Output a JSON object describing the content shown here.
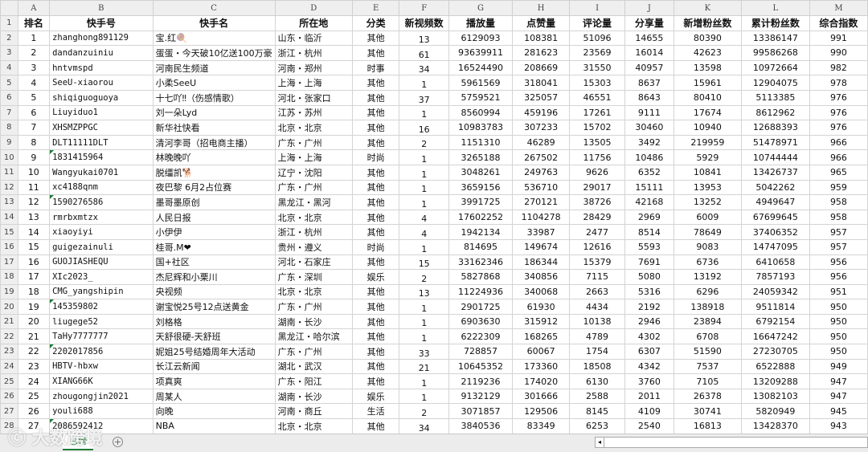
{
  "columns": [
    "A",
    "B",
    "C",
    "D",
    "E",
    "F",
    "G",
    "H",
    "I",
    "J",
    "K",
    "L",
    "M"
  ],
  "headers": [
    "排名",
    "快手号",
    "快手名",
    "所在地",
    "分类",
    "新视频数",
    "播放量",
    "点赞量",
    "评论量",
    "分享量",
    "新增粉丝数",
    "累计粉丝数",
    "综合指数"
  ],
  "rows": [
    [
      "1",
      "zhanghong891129",
      "宝.红🍭",
      "山东・临沂",
      "其他",
      "13",
      "6129093",
      "108381",
      "51096",
      "14655",
      "80390",
      "13386147",
      "991"
    ],
    [
      "2",
      "dandanzuiniu",
      "蛋蛋・今天破10亿送100万豪",
      "浙江・杭州",
      "其他",
      "61",
      "93639911",
      "281623",
      "23569",
      "16014",
      "42623",
      "99586268",
      "990"
    ],
    [
      "3",
      "hntvmspd",
      "河南民生频道",
      "河南・郑州",
      "时事",
      "34",
      "16524490",
      "208669",
      "31550",
      "40957",
      "13598",
      "10972664",
      "982"
    ],
    [
      "4",
      "SeeU-xiaorou",
      "小柔SeeU",
      "上海・上海",
      "其他",
      "1",
      "5961569",
      "318041",
      "15303",
      "8637",
      "15961",
      "12904075",
      "978"
    ],
    [
      "5",
      "shiqiguoguoya",
      "十七吖‼（伤感情歌）",
      "河北・张家口",
      "其他",
      "37",
      "5759521",
      "325057",
      "46551",
      "8643",
      "80410",
      "5113385",
      "976"
    ],
    [
      "6",
      "Liuyiduo1",
      "刘一朵Lyd",
      "江苏・苏州",
      "其他",
      "1",
      "8560994",
      "459196",
      "17261",
      "9111",
      "17674",
      "8612962",
      "976"
    ],
    [
      "7",
      "XHSMZPPGC",
      "新华社快看",
      "北京・北京",
      "其他",
      "16",
      "10983783",
      "307233",
      "15702",
      "30460",
      "10940",
      "12688393",
      "976"
    ],
    [
      "8",
      "DLT11111DLT",
      "清河李哥（招电商主播）",
      "广东・广州",
      "其他",
      "2",
      "1151310",
      "46289",
      "13505",
      "3492",
      "219959",
      "51478971",
      "966"
    ],
    [
      "9",
      "1831415964",
      "林晚晚吖",
      "上海・上海",
      "时尚",
      "1",
      "3265188",
      "267502",
      "11756",
      "10486",
      "5929",
      "10744444",
      "966"
    ],
    [
      "10",
      "Wangyukai0701",
      "脱缰凯🐕",
      "辽宁・沈阳",
      "其他",
      "1",
      "3048261",
      "249763",
      "9626",
      "6352",
      "10841",
      "13426737",
      "965"
    ],
    [
      "11",
      "xc4188qnm",
      "夜巴黎 6月2占位赛",
      "广东・广州",
      "其他",
      "1",
      "3659156",
      "536710",
      "29017",
      "15111",
      "13953",
      "5042262",
      "959"
    ],
    [
      "12",
      "1590276586",
      "墨哥墨原创",
      "黑龙江・黑河",
      "其他",
      "1",
      "3991725",
      "270121",
      "38726",
      "42168",
      "13252",
      "4949647",
      "958"
    ],
    [
      "13",
      "rmrbxmtzx",
      "人民日报",
      "北京・北京",
      "其他",
      "4",
      "17602252",
      "1104278",
      "28429",
      "2969",
      "6009",
      "67699645",
      "958"
    ],
    [
      "14",
      "xiaoyiyi",
      "小伊伊",
      "浙江・杭州",
      "其他",
      "4",
      "1942134",
      "33987",
      "2477",
      "8514",
      "78649",
      "37406352",
      "957"
    ],
    [
      "15",
      "guigezainuli",
      "桂哥.M❤",
      "贵州・遵义",
      "时尚",
      "1",
      "814695",
      "149674",
      "12616",
      "5593",
      "9083",
      "14747095",
      "957"
    ],
    [
      "16",
      "GUOJIASHEQU",
      "国+社区",
      "河北・石家庄",
      "其他",
      "15",
      "33162346",
      "186344",
      "15379",
      "7691",
      "6736",
      "6410658",
      "956"
    ],
    [
      "17",
      "XIc2023_",
      "杰尼辉和小栗川",
      "广东・深圳",
      "娱乐",
      "2",
      "5827868",
      "340856",
      "7115",
      "5080",
      "13192",
      "7857193",
      "956"
    ],
    [
      "18",
      "CMG_yangshipin",
      "央视频",
      "北京・北京",
      "其他",
      "13",
      "11224936",
      "340068",
      "2663",
      "5316",
      "6296",
      "24059342",
      "951"
    ],
    [
      "19",
      "145359802",
      "谢宝悦25号12点送黄金",
      "广东・广州",
      "其他",
      "1",
      "2901725",
      "61930",
      "4434",
      "2192",
      "138918",
      "9511814",
      "950"
    ],
    [
      "20",
      "liugege52",
      "刘格格",
      "湖南・长沙",
      "其他",
      "1",
      "6903630",
      "315912",
      "10138",
      "2946",
      "23894",
      "6792154",
      "950"
    ],
    [
      "21",
      "TaHy7777777",
      "天舒很硬-天舒班",
      "黑龙江・哈尔滨",
      "其他",
      "1",
      "6222309",
      "168265",
      "4789",
      "4302",
      "6708",
      "16647242",
      "950"
    ],
    [
      "22",
      "2202017856",
      "妮姐25号结婚周年大活动",
      "广东・广州",
      "其他",
      "33",
      "728857",
      "60067",
      "1754",
      "6307",
      "51590",
      "27230705",
      "950"
    ],
    [
      "23",
      "HBTV-hbxw",
      "长江云新闻",
      "湖北・武汉",
      "其他",
      "21",
      "10645352",
      "173360",
      "18508",
      "4342",
      "7537",
      "6522888",
      "949"
    ],
    [
      "24",
      "XIANG66K",
      "项真爽",
      "广东・阳江",
      "其他",
      "1",
      "2119236",
      "174020",
      "6130",
      "3760",
      "7105",
      "13209288",
      "947"
    ],
    [
      "25",
      "zhougongjin2021",
      "周某人",
      "湖南・长沙",
      "娱乐",
      "1",
      "9132129",
      "301666",
      "2588",
      "2011",
      "26378",
      "13082103",
      "947"
    ],
    [
      "26",
      "youli688",
      "向晚",
      "河南・商丘",
      "生活",
      "2",
      "3071857",
      "129506",
      "8145",
      "4109",
      "30741",
      "5820949",
      "945"
    ],
    [
      "27",
      "2086592412",
      "NBA",
      "北京・北京",
      "其他",
      "34",
      "3840536",
      "83349",
      "6253",
      "2540",
      "16813",
      "13428370",
      "943"
    ]
  ],
  "text_number_cells": [
    "1831415964",
    "1590276586",
    "145359802",
    "2202017856",
    "2086592412"
  ],
  "sheet_tab": "总榜",
  "add_sheet": "+",
  "scroll_left": "◂",
  "watermark": "大数跨境",
  "accent": "#1e7b34"
}
